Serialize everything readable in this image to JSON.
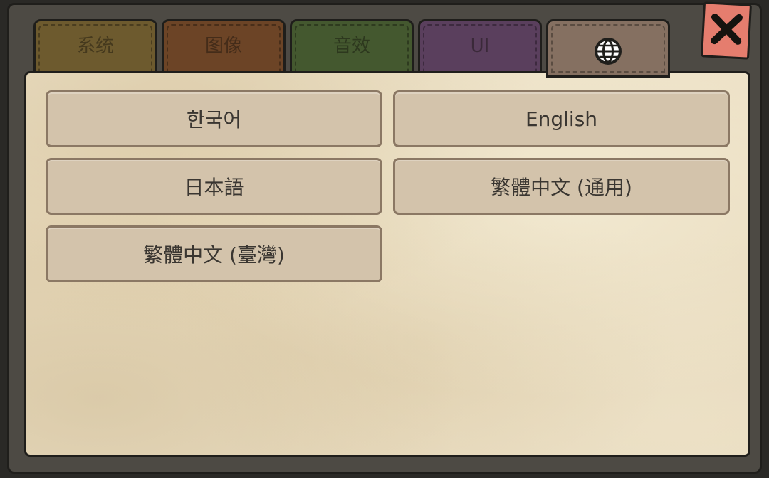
{
  "tabs": {
    "system": "系统",
    "graphics": "图像",
    "audio": "音效",
    "ui": "UI",
    "language_icon": "globe-icon"
  },
  "close_icon": "close-x-icon",
  "languages": [
    "한국어",
    "English",
    "日本語",
    "繁體中文 (通用)",
    "繁體中文 (臺灣)"
  ],
  "colors": {
    "tab_system": "#6d5a2e",
    "tab_graphics": "#6c4426",
    "tab_audio": "#44582f",
    "tab_ui": "#5a3f5d",
    "tab_language_active": "#857061",
    "close_button": "#e57d6e",
    "button_fill": "#d3c3ab",
    "panel_parchment": "#e8dbbf"
  }
}
